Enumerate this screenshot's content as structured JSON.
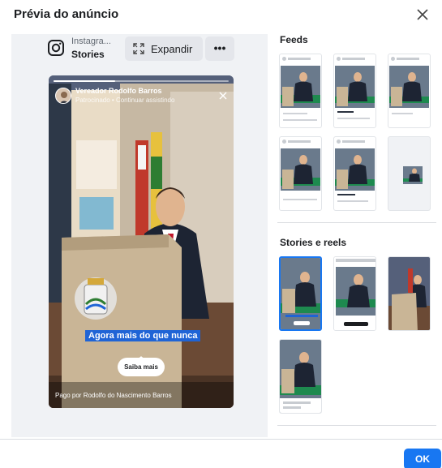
{
  "header": {
    "title": "Prévia do anúncio"
  },
  "preview": {
    "platform": "Instagra...",
    "placement": "Stories",
    "expand_label": "Expandir",
    "more_label": "•••",
    "story": {
      "account_name": "Vereador Rodolfo Barros",
      "sponsored_line": "Patrocinado  •  Continuar assistindo",
      "caption": "Agora mais do que nunca",
      "cta_label": "Saiba mais",
      "paid_by": "Pago por Rodolfo do Nascimento Barros",
      "progress": 0.35
    }
  },
  "sections": {
    "feeds_title": "Feeds",
    "stories_title": "Stories e reels"
  },
  "footer": {
    "ok_label": "OK"
  },
  "colors": {
    "accent": "#1877f2",
    "caption_bg": "#1f64d6",
    "pane_bg": "#f0f2f5"
  }
}
